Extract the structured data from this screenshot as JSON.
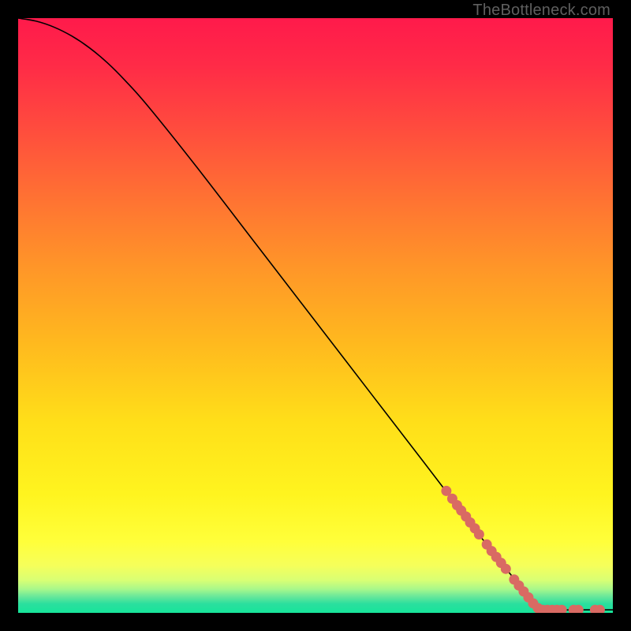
{
  "watermark": "TheBottleneck.com",
  "chart_data": {
    "type": "line",
    "title": "",
    "xlabel": "",
    "ylabel": "",
    "xlim": [
      0,
      100
    ],
    "ylim": [
      0,
      100
    ],
    "grid": false,
    "series": [
      {
        "name": "curve",
        "type": "line",
        "color": "#000000",
        "points": [
          {
            "x": 0,
            "y": 100
          },
          {
            "x": 3,
            "y": 99.5
          },
          {
            "x": 6,
            "y": 98.5
          },
          {
            "x": 9,
            "y": 97
          },
          {
            "x": 12,
            "y": 95
          },
          {
            "x": 15,
            "y": 92.5
          },
          {
            "x": 18,
            "y": 89.5
          },
          {
            "x": 22,
            "y": 85
          },
          {
            "x": 30,
            "y": 75
          },
          {
            "x": 40,
            "y": 62
          },
          {
            "x": 50,
            "y": 49
          },
          {
            "x": 60,
            "y": 36
          },
          {
            "x": 70,
            "y": 23
          },
          {
            "x": 78,
            "y": 12.5
          },
          {
            "x": 84,
            "y": 5
          },
          {
            "x": 87,
            "y": 1.5
          },
          {
            "x": 88,
            "y": 0.7
          },
          {
            "x": 90,
            "y": 0.5
          },
          {
            "x": 95,
            "y": 0.5
          },
          {
            "x": 100,
            "y": 0.5
          }
        ]
      },
      {
        "name": "dots",
        "type": "scatter",
        "color": "#d96a63",
        "points": [
          {
            "x": 72,
            "y": 20.5
          },
          {
            "x": 73,
            "y": 19.2
          },
          {
            "x": 73.8,
            "y": 18.1
          },
          {
            "x": 74.5,
            "y": 17.2
          },
          {
            "x": 75.3,
            "y": 16.2
          },
          {
            "x": 76,
            "y": 15.2
          },
          {
            "x": 76.8,
            "y": 14.2
          },
          {
            "x": 77.5,
            "y": 13.2
          },
          {
            "x": 78.8,
            "y": 11.5
          },
          {
            "x": 79.6,
            "y": 10.4
          },
          {
            "x": 80.4,
            "y": 9.4
          },
          {
            "x": 81.2,
            "y": 8.4
          },
          {
            "x": 82,
            "y": 7.4
          },
          {
            "x": 83.4,
            "y": 5.6
          },
          {
            "x": 84.2,
            "y": 4.6
          },
          {
            "x": 85,
            "y": 3.6
          },
          {
            "x": 85.8,
            "y": 2.6
          },
          {
            "x": 86.6,
            "y": 1.6
          },
          {
            "x": 87.4,
            "y": 0.8
          },
          {
            "x": 88.2,
            "y": 0.5
          },
          {
            "x": 89,
            "y": 0.5
          },
          {
            "x": 89.8,
            "y": 0.5
          },
          {
            "x": 90.6,
            "y": 0.5
          },
          {
            "x": 91.4,
            "y": 0.5
          },
          {
            "x": 93.4,
            "y": 0.5
          },
          {
            "x": 94.2,
            "y": 0.5
          },
          {
            "x": 97,
            "y": 0.5
          },
          {
            "x": 97.8,
            "y": 0.5
          }
        ]
      }
    ],
    "background_gradient": {
      "stops": [
        {
          "offset": 0.0,
          "color": "#ff1a4b"
        },
        {
          "offset": 0.08,
          "color": "#ff2b47"
        },
        {
          "offset": 0.18,
          "color": "#ff4a3e"
        },
        {
          "offset": 0.3,
          "color": "#ff7133"
        },
        {
          "offset": 0.42,
          "color": "#ff9628"
        },
        {
          "offset": 0.55,
          "color": "#ffba1e"
        },
        {
          "offset": 0.68,
          "color": "#ffdf19"
        },
        {
          "offset": 0.8,
          "color": "#fff41f"
        },
        {
          "offset": 0.88,
          "color": "#ffff3a"
        },
        {
          "offset": 0.92,
          "color": "#f6ff5a"
        },
        {
          "offset": 0.945,
          "color": "#d9ff74"
        },
        {
          "offset": 0.96,
          "color": "#a8f88b"
        },
        {
          "offset": 0.972,
          "color": "#6be89a"
        },
        {
          "offset": 0.985,
          "color": "#2adf9e"
        },
        {
          "offset": 1.0,
          "color": "#17e59a"
        }
      ]
    }
  }
}
